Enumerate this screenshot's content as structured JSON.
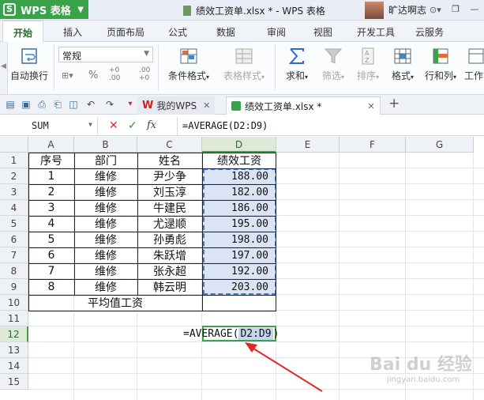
{
  "titlebar": {
    "app_name": "WPS 表格",
    "document_title": "绩效工资单.xlsx * - WPS 表格",
    "user_name": "旷达啊志"
  },
  "menu": {
    "tabs": [
      "开始",
      "插入",
      "页面布局",
      "公式",
      "数据",
      "审阅",
      "视图",
      "开发工具",
      "云服务"
    ],
    "active": "开始"
  },
  "ribbon": {
    "wrap_text": "自动换行",
    "number_format": "常规",
    "percent": "%",
    "conditional_format": "条件格式",
    "table_style": "表格样式",
    "sum": "求和",
    "filter": "筛选",
    "sort": "排序",
    "format": "格式",
    "rows_cols": "行和列",
    "worksheet": "工作"
  },
  "doc_tabs": [
    {
      "label": "我的WPS",
      "active": false
    },
    {
      "label": "绩效工资单.xlsx *",
      "active": true
    }
  ],
  "formula_bar": {
    "name_box": "SUM",
    "fx": "fx",
    "formula": "=AVERAGE(D2:D9)"
  },
  "grid": {
    "columns": [
      "A",
      "B",
      "C",
      "D",
      "E",
      "F",
      "G"
    ],
    "rows": [
      "1",
      "2",
      "3",
      "4",
      "5",
      "6",
      "7",
      "8",
      "9",
      "10",
      "11",
      "12",
      "13",
      "14",
      "15"
    ],
    "headers": [
      "序号",
      "部门",
      "姓名",
      "绩效工资"
    ],
    "data": [
      [
        "1",
        "维修",
        "尹少争",
        "188.00"
      ],
      [
        "2",
        "维修",
        "刘玉淳",
        "182.00"
      ],
      [
        "3",
        "维修",
        "牛建民",
        "186.00"
      ],
      [
        "4",
        "维修",
        "尤逯顺",
        "195.00"
      ],
      [
        "5",
        "维修",
        "孙勇彪",
        "198.00"
      ],
      [
        "6",
        "维修",
        "朱跃增",
        "197.00"
      ],
      [
        "7",
        "维修",
        "张永超",
        "192.00"
      ],
      [
        "8",
        "维修",
        "韩云明",
        "203.00"
      ]
    ],
    "average_label": "平均值工资",
    "editing_formula_prefix": "=AVERAGE(",
    "editing_formula_ref": "D2:D9",
    "editing_formula_suffix": ")"
  },
  "watermark": {
    "main": "Bai du 经验",
    "sub": "jingyan.baidu.com"
  },
  "colors": {
    "accent_green": "#3aa34a",
    "selection_blue": "#4a78c8"
  }
}
